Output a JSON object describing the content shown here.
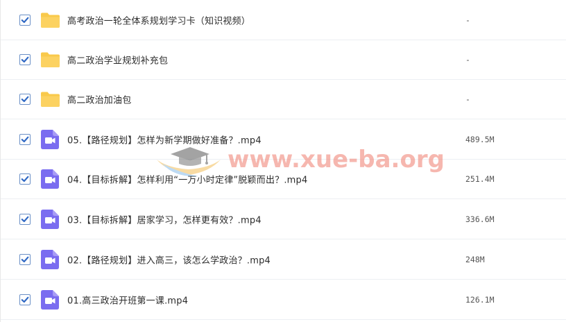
{
  "files": [
    {
      "name": "高考政治一轮全体系规划学习卡（知识视频）",
      "size": "-",
      "type": "folder",
      "checked": true
    },
    {
      "name": "高二政治学业规划补充包",
      "size": "-",
      "type": "folder",
      "checked": true
    },
    {
      "name": "高二政治加油包",
      "size": "-",
      "type": "folder",
      "checked": true
    },
    {
      "name": "05.【路径规划】怎样为新学期做好准备？.mp4",
      "size": "489.5M",
      "type": "video",
      "checked": true
    },
    {
      "name": "04.【目标拆解】怎样利用“一万小时定律”脱颖而出？.mp4",
      "size": "251.4M",
      "type": "video",
      "checked": true
    },
    {
      "name": "03.【目标拆解】居家学习，怎样更有效？.mp4",
      "size": "336.6M",
      "type": "video",
      "checked": true
    },
    {
      "name": "02.【路径规划】进入高三，该怎么学政治？.mp4",
      "size": "248M",
      "type": "video",
      "checked": true
    },
    {
      "name": "01.高三政治开班第一课.mp4",
      "size": "126.1M",
      "type": "video",
      "checked": true
    }
  ],
  "watermark": {
    "text": "www.xue-ba.org"
  },
  "colors": {
    "folder": "#f9c94b",
    "video": "#7a6cf0",
    "checkbox_border": "#6a8fc6",
    "checkmark": "#2f68c4",
    "watermark_text": "#f07e6e"
  }
}
